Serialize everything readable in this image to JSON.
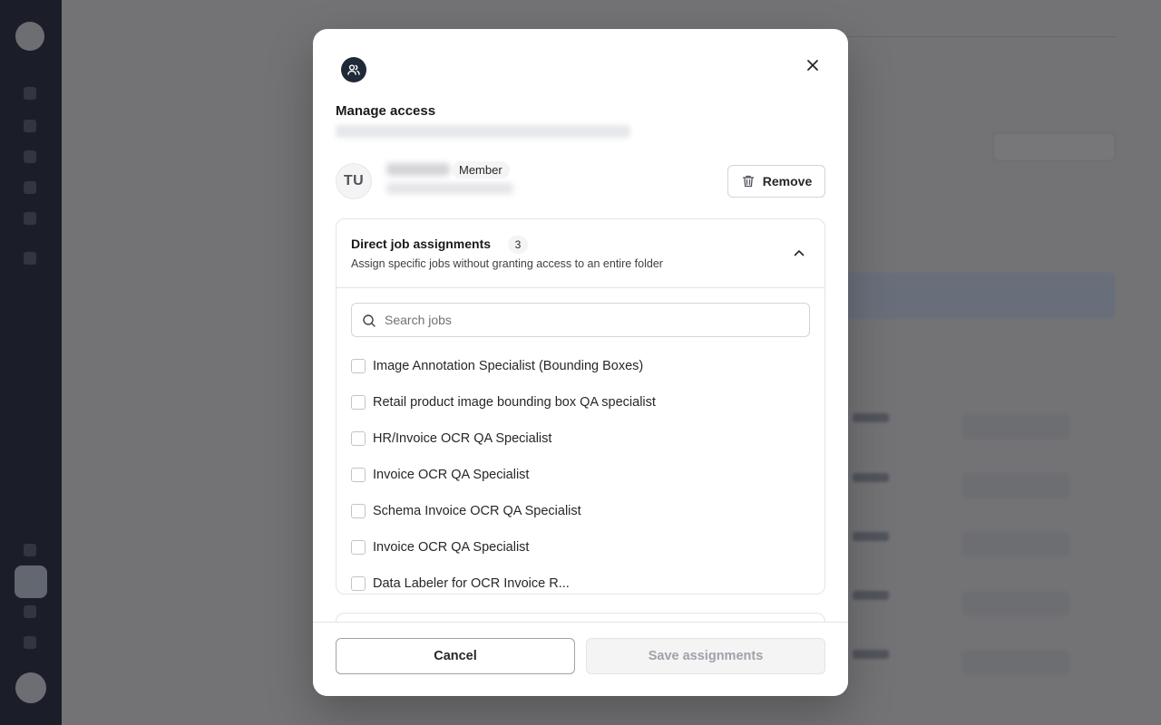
{
  "modal": {
    "title": "Manage access",
    "icon": "users-icon"
  },
  "user": {
    "initials": "TU",
    "role": "Member",
    "remove_label": "Remove"
  },
  "section": {
    "title": "Direct job assignments",
    "count": "3",
    "description": "Assign specific jobs without granting access to an entire folder",
    "expanded": true
  },
  "search": {
    "placeholder": "Search jobs",
    "value": ""
  },
  "jobs": [
    {
      "label": "Image Annotation Specialist (Bounding Boxes)",
      "checked": false
    },
    {
      "label": "Retail product image bounding box QA specialist",
      "checked": false
    },
    {
      "label": "HR/Invoice OCR QA Specialist",
      "checked": false
    },
    {
      "label": "Invoice OCR QA Specialist",
      "checked": false
    },
    {
      "label": "Schema Invoice OCR QA Specialist",
      "checked": false
    },
    {
      "label": "Invoice OCR QA Specialist",
      "checked": false
    },
    {
      "label": "Data Labeler for OCR Invoice R...",
      "checked": false
    }
  ],
  "footer": {
    "cancel_label": "Cancel",
    "save_label": "Save assignments"
  }
}
